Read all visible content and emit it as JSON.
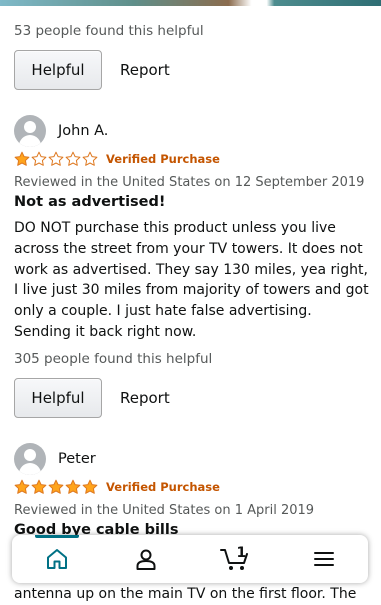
{
  "prev_review": {
    "helpful_count": "53 people found this helpful",
    "helpful_label": "Helpful",
    "report_label": "Report"
  },
  "reviews": [
    {
      "name": "John A.",
      "rating": 1,
      "verified": "Verified Purchase",
      "reviewed_on": "Reviewed in the United States on 12 September 2019",
      "title": "Not as advertised!",
      "body": "DO NOT purchase this product unless you live across the street from your TV towers. It does not work as advertised. They say 130 miles, yea right, I live just 30 miles from majority of towers and got only a couple. I just hate false advertising. Sending it back right now.",
      "helpful_count": "305 people found this helpful",
      "helpful_label": "Helpful",
      "report_label": "Report"
    },
    {
      "name": "Peter",
      "rating": 5,
      "verified": "Verified Purchase",
      "reviewed_on": "Reviewed in the United States on 1 April 2019",
      "title": "Good bye cable bills",
      "body_tail": "antenna up on the main TV on the first floor. The"
    }
  ],
  "nav": {
    "items": [
      "home-icon",
      "account-icon",
      "cart-icon",
      "menu-icon"
    ],
    "cart_count": "1",
    "active": "home"
  },
  "colors": {
    "star": "#ffa41c",
    "star_outline": "#de7921",
    "verified": "#c45500",
    "active_nav": "#007185"
  }
}
